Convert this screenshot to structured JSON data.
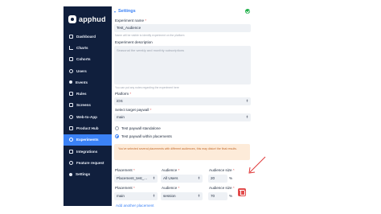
{
  "logo": {
    "text": "apphud"
  },
  "sidebar": {
    "items": [
      {
        "label": "Dashboard",
        "icon": "dashboard-icon"
      },
      {
        "label": "Charts",
        "icon": "charts-icon"
      },
      {
        "label": "Cohorts",
        "icon": "cohorts-icon"
      },
      {
        "label": "Users",
        "icon": "users-icon"
      },
      {
        "label": "Events",
        "icon": "events-icon"
      },
      {
        "label": "Rules",
        "icon": "rules-icon"
      },
      {
        "label": "Screens",
        "icon": "screens-icon"
      },
      {
        "label": "Web-to-App",
        "icon": "web-to-app-icon"
      },
      {
        "label": "Product Hub",
        "icon": "product-hub-icon"
      },
      {
        "label": "Experiments",
        "icon": "experiments-icon",
        "active": true
      },
      {
        "label": "Integrations",
        "icon": "integrations-icon"
      },
      {
        "label": "Feature request",
        "icon": "feature-request-icon"
      },
      {
        "label": "Settings",
        "icon": "settings-icon"
      }
    ]
  },
  "section": {
    "title": "Settings",
    "status_color": "#22b14c"
  },
  "form": {
    "experiment_name": {
      "label": "Experiment name",
      "required": "*",
      "value": "Test_Audience",
      "help": "Name will be visible to identify experiment on the platform"
    },
    "experiment_description": {
      "label": "Experiment description",
      "placeholder": "Seasonal the weekly and monthly subscriptions",
      "help": "You can put any notes regarding the experiment here"
    },
    "platform": {
      "label": "Platform",
      "required": "*",
      "value": "iOS"
    },
    "target_paywall": {
      "label": "Select target paywall",
      "required": "*",
      "value": "main"
    },
    "paywall_mode": {
      "options": [
        {
          "label": "Test paywall standalone",
          "selected": false
        },
        {
          "label": "Test paywall within placements",
          "selected": true
        }
      ]
    },
    "warning": "You've selected several placements with different audiences, this may distort the final results.",
    "rows": [
      {
        "placement_label": "Placement",
        "placement_value": "Placement_test_...",
        "audience_label": "Audience",
        "audience_value": "All Users",
        "size_label": "Audience size",
        "size_value": "20",
        "unit": "%"
      },
      {
        "placement_label": "Placement",
        "placement_value": "main",
        "audience_label": "Audience",
        "audience_value": "session",
        "size_label": "Audience size",
        "size_value": "70",
        "unit": "%"
      }
    ],
    "required_mark": "*",
    "add_link": "Add another placement"
  },
  "colors": {
    "accent": "#3b82f6",
    "sidebar_bg": "#101f3d",
    "danger": "#e24b4b",
    "warning_bg": "#fdebd9",
    "arrow": "#e03a3a"
  }
}
